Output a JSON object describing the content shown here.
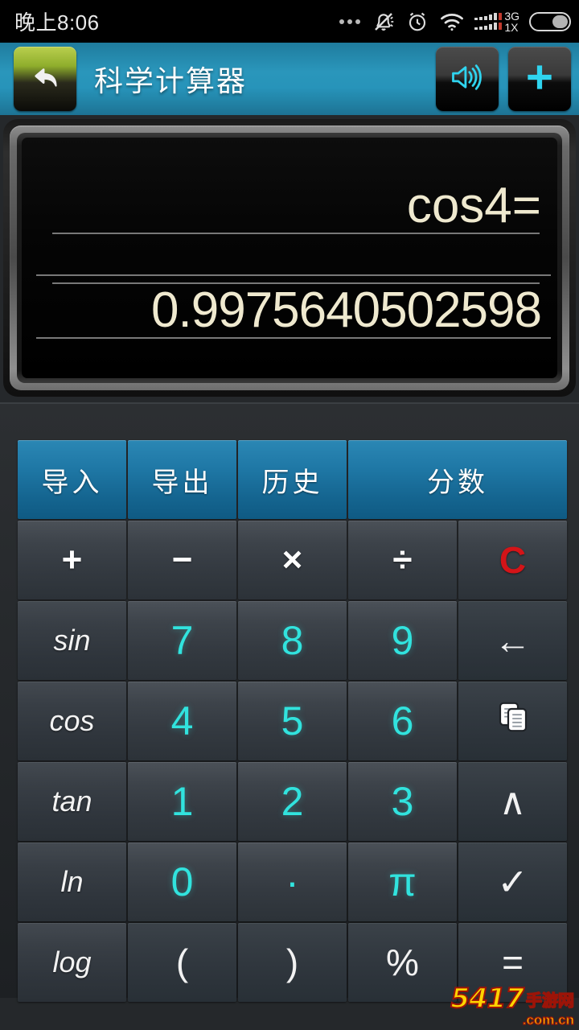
{
  "statusbar": {
    "time": "晚上8:06",
    "icons": [
      "more-dots-icon",
      "silent-bell-icon",
      "alarm-clock-icon",
      "wifi-icon",
      "signal-bars-icon",
      "battery-icon"
    ],
    "network_primary": "3G",
    "network_secondary": "1X"
  },
  "titlebar": {
    "back_icon": "back-arrow-icon",
    "title": "科学计算器",
    "sound_icon": "speaker-icon",
    "add_icon": "plus-icon",
    "background_color": "#2794ba"
  },
  "display": {
    "expression": "cos4=",
    "result": "0.9975640502598",
    "text_color": "#efe9cf",
    "background_color": "#000000"
  },
  "keypad": {
    "accent_blue": "#1f78a6",
    "number_color": "#31e3de",
    "clear_color": "#d41418",
    "rows": [
      {
        "name": "toolbar-row",
        "keys": [
          {
            "label": "导入",
            "name": "import-button",
            "style": "blue",
            "span": 1
          },
          {
            "label": "导出",
            "name": "export-button",
            "style": "blue",
            "span": 1
          },
          {
            "label": "历史",
            "name": "history-button",
            "style": "blue",
            "span": 1
          },
          {
            "label": "分数",
            "name": "fraction-button",
            "style": "blue",
            "span": 2
          }
        ]
      },
      {
        "name": "operator-row",
        "keys": [
          {
            "label": "+",
            "name": "plus-button",
            "style": "op",
            "span": 1
          },
          {
            "label": "−",
            "name": "minus-button",
            "style": "op",
            "span": 1
          },
          {
            "label": "×",
            "name": "multiply-button",
            "style": "op",
            "span": 1
          },
          {
            "label": "÷",
            "name": "divide-button",
            "style": "op",
            "span": 1
          },
          {
            "label": "C",
            "name": "clear-button",
            "style": "clear",
            "span": 1
          }
        ]
      },
      {
        "name": "row-789",
        "keys": [
          {
            "label": "sin",
            "name": "sin-button",
            "style": "fn",
            "span": 1
          },
          {
            "label": "7",
            "name": "digit-7-button",
            "style": "num",
            "span": 1
          },
          {
            "label": "8",
            "name": "digit-8-button",
            "style": "num",
            "span": 1
          },
          {
            "label": "9",
            "name": "digit-9-button",
            "style": "num",
            "span": 1
          },
          {
            "label": "←",
            "name": "backspace-button",
            "style": "glyph",
            "span": 1
          }
        ]
      },
      {
        "name": "row-456",
        "keys": [
          {
            "label": "cos",
            "name": "cos-button",
            "style": "fn",
            "span": 1
          },
          {
            "label": "4",
            "name": "digit-4-button",
            "style": "num",
            "span": 1
          },
          {
            "label": "5",
            "name": "digit-5-button",
            "style": "num",
            "span": 1
          },
          {
            "label": "6",
            "name": "digit-6-button",
            "style": "num",
            "span": 1
          },
          {
            "label": "copy-icon",
            "name": "copy-button",
            "style": "icon",
            "span": 1
          }
        ]
      },
      {
        "name": "row-123",
        "keys": [
          {
            "label": "tan",
            "name": "tan-button",
            "style": "fn",
            "span": 1
          },
          {
            "label": "1",
            "name": "digit-1-button",
            "style": "num",
            "span": 1
          },
          {
            "label": "2",
            "name": "digit-2-button",
            "style": "num",
            "span": 1
          },
          {
            "label": "3",
            "name": "digit-3-button",
            "style": "num",
            "span": 1
          },
          {
            "label": "∧",
            "name": "power-button",
            "style": "glyph",
            "span": 1
          }
        ]
      },
      {
        "name": "row-0",
        "keys": [
          {
            "label": "ln",
            "name": "ln-button",
            "style": "fn",
            "span": 1
          },
          {
            "label": "0",
            "name": "digit-0-button",
            "style": "num",
            "span": 1
          },
          {
            "label": "·",
            "name": "decimal-point-button",
            "style": "dot",
            "span": 1
          },
          {
            "label": "π",
            "name": "pi-button",
            "style": "num",
            "span": 1
          },
          {
            "label": "✓",
            "name": "sqrt-button",
            "style": "glyph",
            "span": 1
          }
        ]
      },
      {
        "name": "row-paren",
        "keys": [
          {
            "label": "log",
            "name": "log-button",
            "style": "fn",
            "span": 1
          },
          {
            "label": "(",
            "name": "open-paren-button",
            "style": "glyph",
            "span": 1
          },
          {
            "label": ")",
            "name": "close-paren-button",
            "style": "glyph",
            "span": 1
          },
          {
            "label": "%",
            "name": "percent-button",
            "style": "glyph",
            "span": 1
          },
          {
            "label": "=",
            "name": "equals-button",
            "style": "glyph",
            "span": 1
          }
        ]
      }
    ]
  },
  "watermark": {
    "number": "5417",
    "suffix": "手游网",
    "domain": ".com.cn",
    "color": "#ffd400"
  }
}
